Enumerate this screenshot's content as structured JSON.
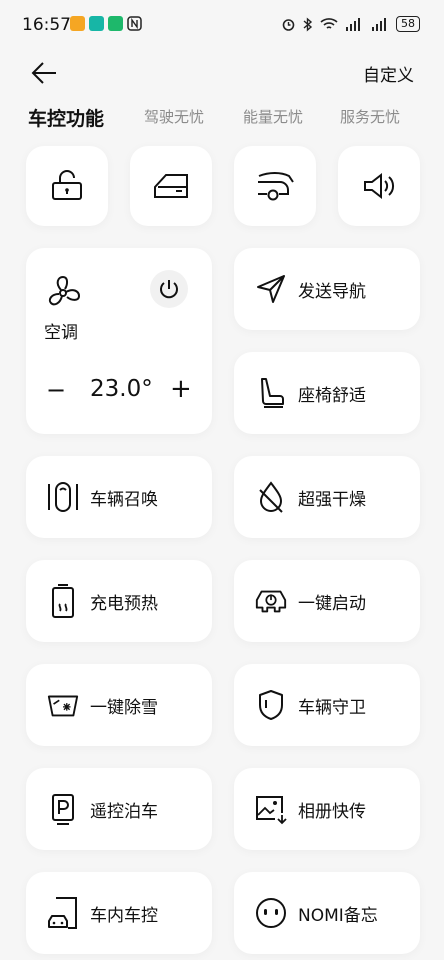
{
  "status": {
    "time": "16:57",
    "battery": "58"
  },
  "header": {
    "custom_label": "自定义"
  },
  "tabs": [
    {
      "label": "车控功能"
    },
    {
      "label": "驾驶无忧"
    },
    {
      "label": "能量无忧"
    },
    {
      "label": "服务无忧"
    }
  ],
  "climate": {
    "label": "空调",
    "temperature": "23.0°",
    "minus": "−",
    "plus": "+"
  },
  "functions": [
    {
      "label": "发送导航",
      "icon": "send-navigation-icon"
    },
    {
      "label": "座椅舒适",
      "icon": "seat-icon"
    },
    {
      "label": "车辆召唤",
      "icon": "vehicle-summon-icon"
    },
    {
      "label": "超强干燥",
      "icon": "dry-drop-icon"
    },
    {
      "label": "充电预热",
      "icon": "battery-preheat-icon"
    },
    {
      "label": "一键启动",
      "icon": "car-start-icon"
    },
    {
      "label": "一键除雪",
      "icon": "windshield-snow-icon"
    },
    {
      "label": "车辆守卫",
      "icon": "shield-icon"
    },
    {
      "label": "遥控泊车",
      "icon": "parking-icon"
    },
    {
      "label": "相册快传",
      "icon": "photo-transfer-icon"
    },
    {
      "label": "车内车控",
      "icon": "in-car-control-icon"
    },
    {
      "label": "NOMI备忘",
      "icon": "nomi-face-icon"
    }
  ]
}
